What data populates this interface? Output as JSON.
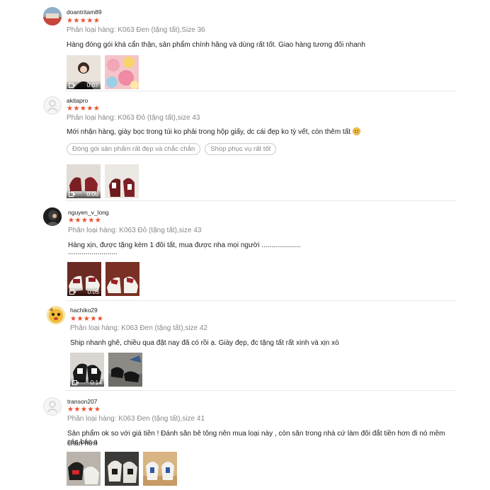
{
  "reviews": [
    {
      "username": "doantritam89",
      "stars": "★★★★★",
      "variant": "Phân loại hàng: K063 Đen (tặng tất),Size 36",
      "text": "Hàng đóng gói khá cẩn thận, sản phẩm chính hãng và dùng rất tốt. Giao hàng tương đối nhanh",
      "video_duration": "0:07"
    },
    {
      "username": "akitapro",
      "stars": "★★★★★",
      "variant": "Phân loại hàng: K063 Đỏ (tặng tất),size 43",
      "text": "Mới nhận hàng, giày bọc trong túi ko phải trong hộp giấy, dc cái đẹp ko tỳ vết, còn thêm tất",
      "tags": [
        "Đóng gói sản phẩm rất đẹp và chắc chắn",
        "Shop phục vụ rất tốt"
      ],
      "video_duration": "0:06"
    },
    {
      "username": "nguyen_v_long",
      "stars": "★★★★★",
      "variant": "Phân loại hàng: K063 Đỏ (tặng tất),size 43",
      "text": "Hàng xịn, được tặng kèm 1 đôi tất, mua được nha mọi người ....................",
      "text2": ".........................",
      "video_duration": "0:05"
    },
    {
      "username": "hachiko29",
      "stars": "★★★★★",
      "variant": "Phân loại hàng: K063 Đen (tặng tất),size 42",
      "text": "Ship nhanh ghê, chiều qua đặt nay đã có rồi ạ. Giày đẹp, đc tặng tất rất xinh và xịn xò",
      "video_duration": "0:14"
    },
    {
      "username": "transon207",
      "stars": "★★★★★",
      "variant": "Phân loại hàng: K063 Đen (tặng tất),size 41",
      "text": "Sản phẩm ok so với giá tiền ! Đánh săn bê tông nên mua loại này , còn săn trong nhà cứ làm đôi đắt tiền hơn đi nó mềm chân hơn",
      "text2": "các bác ạ"
    }
  ],
  "colors": {
    "star": "#ee4d2d",
    "muted": "#888888",
    "divider": "#e8e8e8"
  }
}
